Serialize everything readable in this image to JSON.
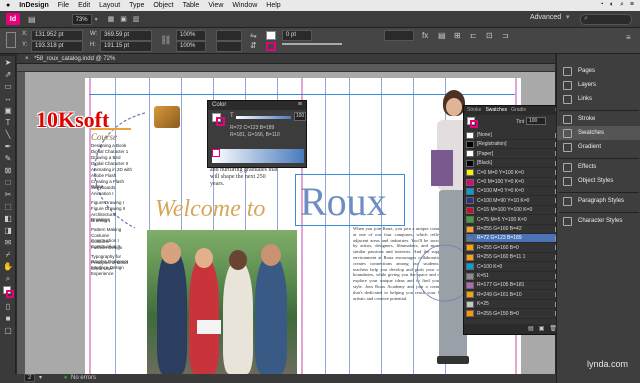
{
  "menubar": {
    "app_name": "InDesign",
    "items": [
      "File",
      "Edit",
      "Layout",
      "Type",
      "Object",
      "Table",
      "View",
      "Window",
      "Help"
    ]
  },
  "appbar": {
    "zoom": "73%",
    "workspace": "Advanced"
  },
  "control": {
    "x": "131.952 pt",
    "y": "193.318 pt",
    "w": "369.59 pt",
    "h": "191.15 pt",
    "stroke_weight": "0 pt",
    "percent_a": "100%",
    "percent_b": "100%"
  },
  "document": {
    "tab_title": "*58_roux_catalog.indd @ 72%",
    "page_number": "2",
    "status": "No errors"
  },
  "watermark": {
    "text": "10Ksoft"
  },
  "color_panel": {
    "title": "Color",
    "tint": "100",
    "rgb_line1": "R=72 C=123 B=189",
    "rgb_line2": "R=181, G=166, B=110"
  },
  "page": {
    "heading_welcome": "Welcome to",
    "heading_roux": "Roux",
    "courses_label": "Course",
    "intro_text": "faculty, developing courses and nurturing graduates that will shape the next 250 years.",
    "body_text": "When you join Roux, you join a unique community at one of our four campuses, which reflect our adjacent areas and industries. You'll be surrounded by artists, designers, filmmakers, and more with similar passions and interests. And the supportive environment at Roux encourages collaboration and creates connections among our students. Our teachers help you develop and push your creative boundaries, while giving you the space and time to explore your unique ideas and to find your own style. Join Roux Academy and join a community that's dedicated to helping you reach your highest artistic and creative potential.",
    "toc": [
      "Designing a Book",
      "Digital Character 1",
      "Drawing a Bird",
      "Digital Character II",
      "Animating in 2D with",
      "Adobe Flash",
      "Creating a Flash Game",
      "Storyboards",
      "Animation I",
      "Figure Drawing I",
      "Figure Drawing II",
      "Architectural Drawings",
      "Drafting 1",
      "Pattern Making",
      "Costume Construction I",
      "Costume Construction II",
      "Fashion Design",
      "Typography for Graphic Designers",
      "Principles of Good Interface Design",
      "Great User Experience"
    ]
  },
  "swatches_panel": {
    "tabs": [
      "Stroke",
      "Swatches",
      "Gradie"
    ],
    "tint_label": "Tint",
    "tint_value": "100",
    "rows": [
      {
        "name": "[None]",
        "color": "#ffffff"
      },
      {
        "name": "[Registration]",
        "color": "#000000"
      },
      {
        "name": "[Paper]",
        "color": "#ffffff"
      },
      {
        "name": "[Black]",
        "color": "#000000"
      },
      {
        "name": "C=0 M=0 Y=100 K=0",
        "color": "#ffef00"
      },
      {
        "name": "C=0 M=100 Y=0 K=0",
        "color": "#e6007e"
      },
      {
        "name": "C=100 M=0 Y=0 K=0",
        "color": "#009fe3"
      },
      {
        "name": "C=100 M=90 Y=10 K=0",
        "color": "#27348b"
      },
      {
        "name": "C=15 M=100 Y=100 K=0",
        "color": "#c8102e"
      },
      {
        "name": "C=75 M=5 Y=100 K=0",
        "color": "#3aa935"
      },
      {
        "name": "R=255 G=160 B=42",
        "color": "#ffa02a"
      },
      {
        "name": "R=72 G=123 B=189",
        "color": "#487bbd"
      },
      {
        "name": "R=255 G=160 B=0",
        "color": "#ffa000"
      },
      {
        "name": "R=255 G=160 B=11 1",
        "color": "#ffa00b"
      },
      {
        "name": "C=100 K=0",
        "color": "#00a0e0"
      },
      {
        "name": "K=51",
        "color": "#8c8c8c"
      },
      {
        "name": "R=177 G=105 B=181",
        "color": "#b169b5"
      },
      {
        "name": "R=249 G=161 B=10",
        "color": "#f9a10a"
      },
      {
        "name": "K=25",
        "color": "#c6c6c6"
      },
      {
        "name": "R=255 G=150 B=0",
        "color": "#ff9600"
      }
    ],
    "selected_index": 11
  },
  "dock": {
    "groups": [
      [
        "Pages",
        "Layers",
        "Links"
      ],
      [
        "Stroke",
        "Swatches",
        "Gradient"
      ],
      [
        "Effects",
        "Object Styles"
      ],
      [
        "Paragraph Styles"
      ],
      [
        "Character Styles"
      ]
    ]
  },
  "lynda": {
    "text": "lynda.com"
  }
}
